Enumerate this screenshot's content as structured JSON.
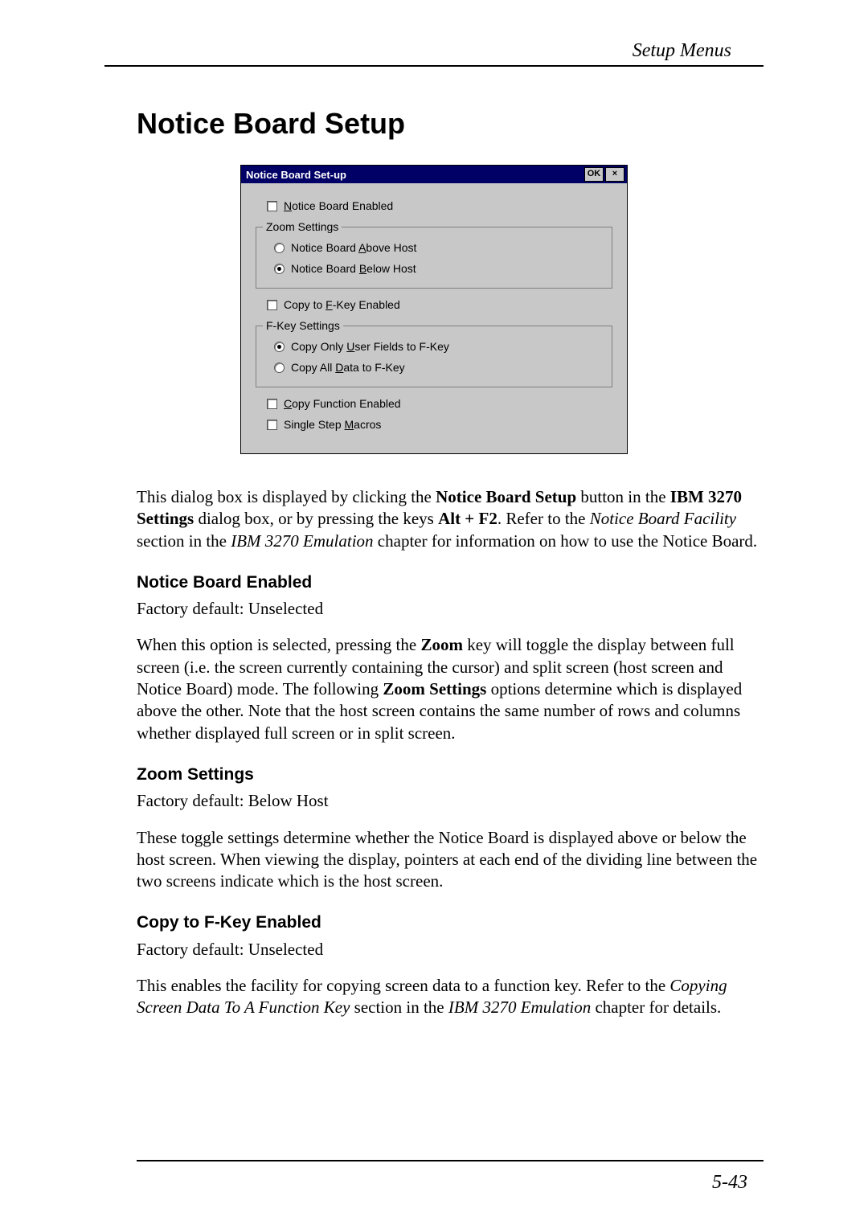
{
  "header": {
    "running": "Setup Menus"
  },
  "h1": "Notice Board Setup",
  "dialog": {
    "title": "Notice Board Set-up",
    "ok": "OK",
    "close": "×",
    "enabled": {
      "pre": "",
      "u": "N",
      "post": "otice Board Enabled"
    },
    "zoom_legend": "Zoom Settings",
    "zoom_above": {
      "pre": "Notice Board ",
      "u": "A",
      "post": "bove Host"
    },
    "zoom_below": {
      "pre": "Notice Board ",
      "u": "B",
      "post": "elow Host"
    },
    "copyF": {
      "pre": "Copy to ",
      "u": "F",
      "post": "-Key Enabled"
    },
    "fkey_legend": "F-Key Settings",
    "fkey_user": {
      "pre": "Copy Only ",
      "u": "U",
      "post": "ser Fields to F-Key"
    },
    "fkey_all": {
      "pre": "Copy All ",
      "u": "D",
      "post": "ata to F-Key"
    },
    "copyFn": {
      "pre": "",
      "u": "C",
      "post": "opy Function Enabled"
    },
    "step": {
      "pre": "Single Step ",
      "u": "M",
      "post": "acros"
    }
  },
  "intro": {
    "t1": "This dialog box is displayed by clicking the ",
    "b1": "Notice Board Setup",
    "t2": " button in the ",
    "b2": "IBM 3270 Settings",
    "t3": " dialog box, or by pressing the keys ",
    "b3": "Alt + F2",
    "t4": ". Refer to the ",
    "i1": "Notice Board Facility",
    "t5": " section in the ",
    "i2": "IBM 3270 Emulation",
    "t6": " chapter for information on how to use the Notice Board."
  },
  "sec1": {
    "h": "Notice Board Enabled",
    "default": "Factory default: Unselected",
    "p_a": "When this option is selected, pressing the ",
    "p_b": "Zoom",
    "p_c": " key will toggle the display between full screen (i.e. the screen currently containing the cursor) and split screen (host screen and Notice Board) mode. The following ",
    "p_d": "Zoom Settings",
    "p_e": " options determine which is displayed above the other. Note that the host screen contains the same number of rows and columns whether displayed full screen or in split screen."
  },
  "sec2": {
    "h": "Zoom Settings",
    "default": "Factory default: Below Host",
    "p": "These toggle settings determine whether the Notice Board is displayed above or below the host screen. When viewing the display, pointers at each end of the dividing line between the two screens indicate which is the host screen."
  },
  "sec3": {
    "h": "Copy to F-Key Enabled",
    "default": "Factory default: Unselected",
    "p_a": "This enables the facility for copying screen data to a function key. Refer to the ",
    "p_i": "Copying Screen Data To A Function Key",
    "p_b": " section in the ",
    "p_i2": "IBM 3270 Emulation",
    "p_c": " chapter for details."
  },
  "footer": {
    "page": "5-43"
  }
}
